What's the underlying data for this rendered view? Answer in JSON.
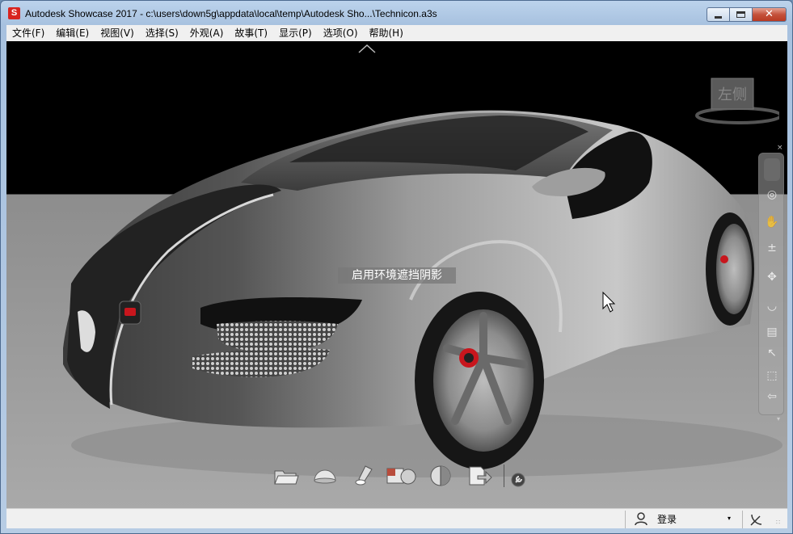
{
  "window": {
    "app_icon_letter": "S",
    "title": "Autodesk Showcase 2017 - c:\\users\\down5g\\appdata\\local\\temp\\Autodesk Sho...\\Technicon.a3s",
    "close_glyph": "✕"
  },
  "menu": {
    "items": [
      {
        "label": "文件(F)"
      },
      {
        "label": "编辑(E)"
      },
      {
        "label": "视图(V)"
      },
      {
        "label": "选择(S)"
      },
      {
        "label": "外观(A)"
      },
      {
        "label": "故事(T)"
      },
      {
        "label": "显示(P)"
      },
      {
        "label": "选项(O)"
      },
      {
        "label": "帮助(H)"
      }
    ]
  },
  "viewport": {
    "tooltip": "启用环境遮挡阴影",
    "viewcube_face": "左侧",
    "nav_close": "×",
    "nav_tools": [
      "steering-wheel",
      "pan",
      "zoom",
      "orbit",
      "look",
      "rewind",
      "center",
      "walk",
      "zoom-window",
      "back"
    ]
  },
  "shelf": {
    "tools": [
      "open-folder",
      "environment-dome",
      "lighting",
      "materials",
      "appearance-sphere",
      "export"
    ]
  },
  "status": {
    "login_label": "登录",
    "dropdown_arrow": "▾",
    "grip": "∷"
  },
  "colors": {
    "titlebar": "#a7c1df",
    "menubar": "#f0f0f0",
    "viewport_top": "#000000",
    "viewport_floor": "#a9a9a9",
    "brake_caliper": "#c8161d"
  }
}
